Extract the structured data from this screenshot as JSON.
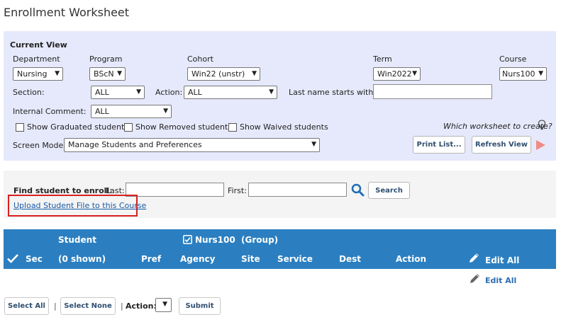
{
  "page": {
    "title": "Enrollment Worksheet"
  },
  "current_view": {
    "title": "Current View",
    "department": {
      "label": "Department",
      "value": "Nursing"
    },
    "program": {
      "label": "Program",
      "value": "BScN"
    },
    "cohort": {
      "label": "Cohort",
      "value": "Win22 (unstr)"
    },
    "term": {
      "label": "Term",
      "value": "Win2022"
    },
    "course": {
      "label": "Course",
      "value": "Nurs100"
    },
    "section": {
      "label": "Section:",
      "value": "ALL"
    },
    "action": {
      "label": "Action:",
      "value": "ALL"
    },
    "last_name": {
      "label": "Last name starts with:",
      "value": ""
    },
    "internal_comment": {
      "label": "Internal Comment:",
      "value": "ALL"
    },
    "show_graduated": {
      "label": "Show Graduated students",
      "checked": false
    },
    "show_removed": {
      "label": "Show Removed students",
      "checked": false
    },
    "show_waived": {
      "label": "Show Waived students",
      "checked": false
    },
    "worksheet_question": "Which worksheet to create?",
    "screen_mode": {
      "label": "Screen Mode:",
      "value": "Manage Students and Preferences"
    },
    "print_list_label": "Print List...",
    "refresh_view_label": "Refresh View"
  },
  "find": {
    "label": "Find student to enroll",
    "colon": ":",
    "last_label": "Last:",
    "first_label": "First:",
    "last_value": "",
    "first_value": "",
    "search_label": "Search",
    "upload_link": "Upload Student File to this Course"
  },
  "table": {
    "header": {
      "sec": "Sec",
      "student": "Student",
      "shown": "(0 shown)",
      "course_group": "Nurs100  (Group)",
      "pref": "Pref",
      "agency": "Agency",
      "site": "Site",
      "service": "Service",
      "dest": "Dest",
      "action": "Action",
      "edit_all": "Edit All"
    },
    "edit_all_below": "Edit All"
  },
  "bottom": {
    "select_all": "Select All",
    "separator": "|",
    "select_none": "Select None",
    "action_label": "Action:",
    "action_value": "",
    "submit": "Submit"
  },
  "colors": {
    "panel": "#e6e9fb",
    "table_header": "#2b7fc1",
    "link": "#1a5aa6",
    "highlight_box": "#d9201f",
    "refresh_arrow": "#f08a84"
  },
  "icons": [
    "chevron-down-icon",
    "lightbulb-icon",
    "play-arrow-icon",
    "search-icon",
    "checkmark-icon",
    "checkbox-checked-icon",
    "pencil-icon"
  ]
}
